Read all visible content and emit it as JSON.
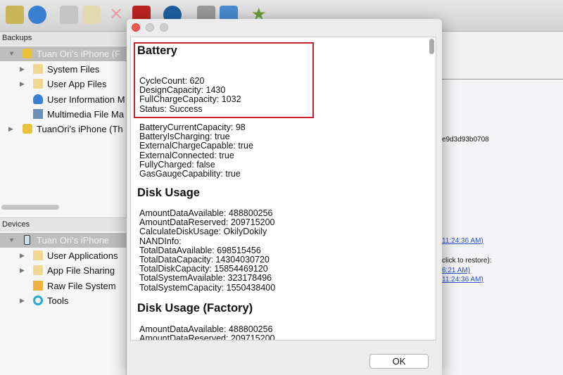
{
  "toolbar": {
    "icons": [
      "import-folder-icon",
      "refresh-icon",
      "copy-icon",
      "clean-icon",
      "delete-icon",
      "toolbox-icon",
      "upload-icon",
      "tools-icon",
      "pen-icon",
      "star-icon"
    ]
  },
  "sidebar": {
    "backups_header": "Backups",
    "backups": [
      {
        "label": "Tuan Ori's iPhone (F",
        "selected": true,
        "icon": "database-icon"
      },
      {
        "label": "System Files",
        "icon": "folder-icon"
      },
      {
        "label": "User App Files",
        "icon": "folder-icon"
      },
      {
        "label": "User Information M",
        "icon": "user-icon"
      },
      {
        "label": "Multimedia File Ma",
        "icon": "image-icon"
      },
      {
        "label": "TuanOri's iPhone (Th",
        "icon": "database-icon"
      }
    ],
    "devices_header": "Devices",
    "devices": [
      {
        "label": "Tuan Ori's iPhone",
        "selected": true,
        "icon": "iphone-icon"
      },
      {
        "label": "User Applications",
        "icon": "folder-icon"
      },
      {
        "label": "App File Sharing",
        "icon": "folder-icon"
      },
      {
        "label": "Raw File System",
        "icon": "raw-files-icon"
      },
      {
        "label": "Tools",
        "icon": "tools-icon"
      }
    ]
  },
  "right_panel": {
    "hash": "e9d3d93b0708",
    "link1": "11:24:36 AM)",
    "restore_label": "click to restore):",
    "link2": "6:21 AM)",
    "link3": "11:24:36 AM)"
  },
  "dialog": {
    "battery": {
      "title": "Battery",
      "highlighted": [
        "CycleCount: 620",
        "DesignCapacity: 1430",
        "FullChargeCapacity: 1032",
        "Status: Success"
      ],
      "lines": [
        "BatteryCurrentCapacity: 98",
        "BatteryIsCharging: true",
        "ExternalChargeCapable: true",
        "ExternalConnected: true",
        "FullyCharged: false",
        "GasGaugeCapability: true"
      ]
    },
    "disk": {
      "title": "Disk Usage",
      "lines": [
        "AmountDataAvailable: 488800256",
        "AmountDataReserved: 209715200",
        "CalculateDiskUsage: OkilyDokily",
        "NANDInfo:",
        "TotalDataAvailable: 698515456",
        "TotalDataCapacity: 14304030720",
        "TotalDiskCapacity: 15854469120",
        "TotalSystemAvailable: 323178496",
        "TotalSystemCapacity: 1550438400"
      ]
    },
    "factory": {
      "title": "Disk Usage (Factory)",
      "lines": [
        "AmountDataAvailable: 488800256",
        "AmountDataReserved: 209715200"
      ]
    },
    "ok_label": "OK",
    "highlight_color": "#c8232c"
  }
}
